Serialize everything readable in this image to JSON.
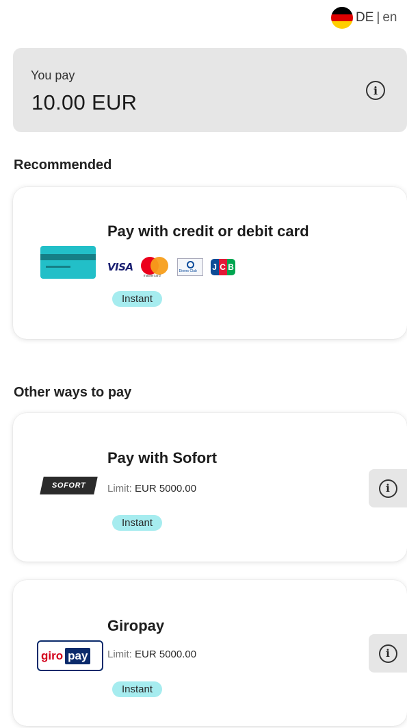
{
  "language": {
    "current": "DE",
    "separator": "|",
    "alternate": "en",
    "flag_colors": [
      "#000000",
      "#dd0000",
      "#ffce00"
    ]
  },
  "payment_summary": {
    "label": "You pay",
    "amount": "10.00 EUR"
  },
  "sections": {
    "recommended": "Recommended",
    "other": "Other ways to pay"
  },
  "methods": [
    {
      "title": "Pay with credit or debit card",
      "brands": [
        "VISA",
        "mastercard",
        "Diners Club",
        "JCB"
      ],
      "badge": "Instant",
      "icon": "credit-card-icon"
    },
    {
      "title": "Pay with Sofort",
      "logo_text": "SOFORT",
      "limit_label": "Limit:",
      "limit_value": "EUR 5000.00",
      "badge": "Instant"
    },
    {
      "title": "Giropay",
      "logo_text": [
        "giro",
        "pay"
      ],
      "limit_label": "Limit:",
      "limit_value": "EUR 5000.00",
      "badge": "Instant"
    }
  ],
  "colors": {
    "badge_bg": "#a6ecef",
    "card_icon": "#22bfc8",
    "summary_bg": "#e6e6e6"
  }
}
